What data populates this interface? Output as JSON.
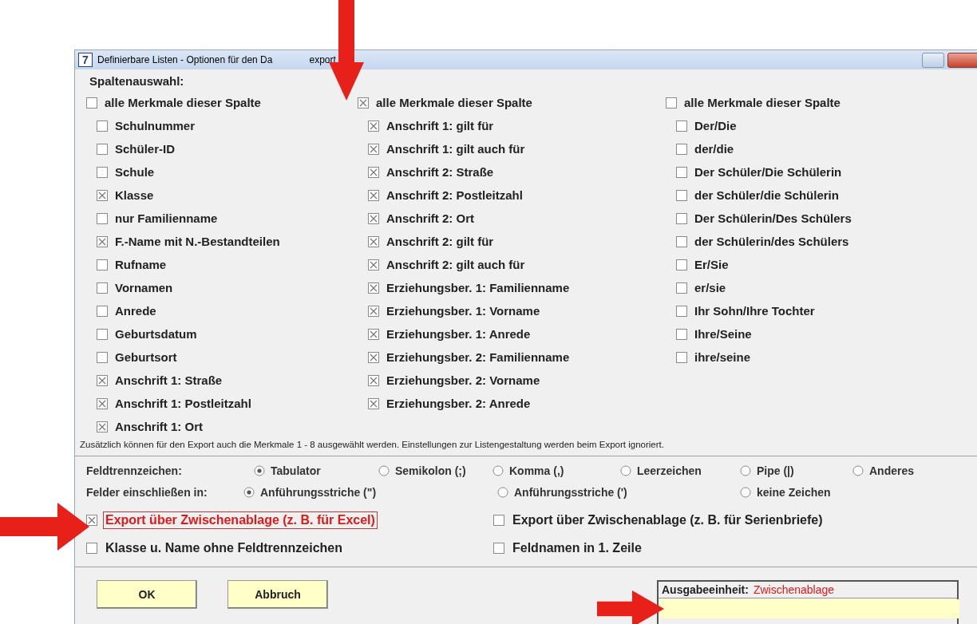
{
  "window": {
    "app_icon": "7",
    "title_parts": [
      "Definierbare Listen - Optionen für den Da",
      "export"
    ]
  },
  "heading": "Spaltenauswahl:",
  "columns": [
    {
      "all": {
        "label": "alle Merkmale dieser Spalte",
        "checked": false
      },
      "items": [
        {
          "label": "Schulnummer",
          "checked": false
        },
        {
          "label": "Schüler-ID",
          "checked": false
        },
        {
          "label": "Schule",
          "checked": false
        },
        {
          "label": "Klasse",
          "checked": true
        },
        {
          "label": "nur Familienname",
          "checked": false
        },
        {
          "label": "F.-Name mit N.-Bestandteilen",
          "checked": true
        },
        {
          "label": "Rufname",
          "checked": false
        },
        {
          "label": "Vornamen",
          "checked": false
        },
        {
          "label": "Anrede",
          "checked": false
        },
        {
          "label": "Geburtsdatum",
          "checked": false
        },
        {
          "label": "Geburtsort",
          "checked": false
        },
        {
          "label": "Anschrift 1: Straße",
          "checked": true
        },
        {
          "label": "Anschrift 1: Postleitzahl",
          "checked": true
        },
        {
          "label": "Anschrift 1: Ort",
          "checked": true
        }
      ]
    },
    {
      "all": {
        "label": "alle Merkmale dieser Spalte",
        "checked": true
      },
      "items": [
        {
          "label": "Anschrift 1: gilt für",
          "checked": true
        },
        {
          "label": "Anschrift 1: gilt auch für",
          "checked": true
        },
        {
          "label": "Anschrift 2: Straße",
          "checked": true
        },
        {
          "label": "Anschrift 2: Postleitzahl",
          "checked": true
        },
        {
          "label": "Anschrift 2: Ort",
          "checked": true
        },
        {
          "label": "Anschrift 2: gilt für",
          "checked": true
        },
        {
          "label": "Anschrift 2: gilt auch für",
          "checked": true
        },
        {
          "label": "Erziehungsber. 1: Familienname",
          "checked": true
        },
        {
          "label": "Erziehungsber. 1: Vorname",
          "checked": true
        },
        {
          "label": "Erziehungsber. 1: Anrede",
          "checked": true
        },
        {
          "label": "Erziehungsber. 2: Familienname",
          "checked": true
        },
        {
          "label": "Erziehungsber. 2: Vorname",
          "checked": true
        },
        {
          "label": "Erziehungsber. 2: Anrede",
          "checked": true
        }
      ]
    },
    {
      "all": {
        "label": "alle Merkmale dieser Spalte",
        "checked": false
      },
      "items": [
        {
          "label": "Der/Die",
          "checked": false
        },
        {
          "label": "der/die",
          "checked": false
        },
        {
          "label": "Der Schüler/Die Schülerin",
          "checked": false
        },
        {
          "label": "der Schüler/die Schülerin",
          "checked": false
        },
        {
          "label": "Der Schülerin/Des Schülers",
          "checked": false
        },
        {
          "label": "der Schülerin/des Schülers",
          "checked": false
        },
        {
          "label": "Er/Sie",
          "checked": false
        },
        {
          "label": "er/sie",
          "checked": false
        },
        {
          "label": "Ihr Sohn/Ihre Tochter",
          "checked": false
        },
        {
          "label": "Ihre/Seine",
          "checked": false
        },
        {
          "label": "ihre/seine",
          "checked": false
        }
      ]
    }
  ],
  "note": "Zusätzlich können für den Export auch die Merkmale 1 - 8 ausgewählt werden. Einstellungen zur Listengestaltung werden beim Export ignoriert.",
  "radio_groups": [
    {
      "label": "Feldtrennzeichen:",
      "options": [
        {
          "label": "Tabulator",
          "selected": true
        },
        {
          "label": "Semikolon (;)",
          "selected": false
        },
        {
          "label": "Komma (,)",
          "selected": false
        },
        {
          "label": "Leerzeichen",
          "selected": false
        },
        {
          "label": "Pipe (|)",
          "selected": false
        },
        {
          "label": "Anderes",
          "selected": false
        }
      ]
    },
    {
      "label": "Felder einschließen in:",
      "options": [
        {
          "label": "Anführungsstriche (\")",
          "selected": true
        },
        {
          "label": "Anführungsstriche (')",
          "selected": false
        },
        {
          "label": "keine Zeichen",
          "selected": false
        }
      ]
    }
  ],
  "options": [
    {
      "label": "Export über Zwischenablage (z. B. für Excel)",
      "checked": true,
      "focused": true
    },
    {
      "label": "Export über Zwischenablage (z. B. für Serienbriefe)",
      "checked": false,
      "focused": false
    },
    {
      "label": "Klasse u. Name ohne Feldtrennzeichen",
      "checked": false,
      "focused": false
    },
    {
      "label": "Feldnamen in 1. Zeile",
      "checked": false,
      "focused": false
    }
  ],
  "buttons": [
    {
      "label": "OK"
    },
    {
      "label": "Abbruch"
    }
  ],
  "output": {
    "label": "Ausgabeeinheit:",
    "value": "Zwischenablage"
  }
}
